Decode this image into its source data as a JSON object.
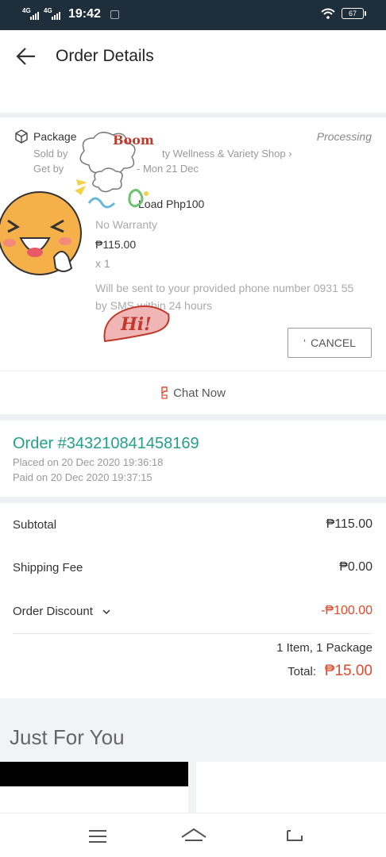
{
  "status_bar": {
    "network1": "4G",
    "network2": "4G",
    "time": "19:42",
    "battery": "67"
  },
  "header": {
    "title": "Order Details"
  },
  "package": {
    "label": "Package",
    "status": "Processing",
    "sold_by": "Sold by",
    "shop_name": "ty Wellness & Variety Shop",
    "get_by": "Get by",
    "delivery_date": "- Mon 21 Dec",
    "product_name": "Load Php100",
    "warranty": "No Warranty",
    "price": "₱115.00",
    "quantity": "x 1",
    "sms_note": "Will be sent to your provided phone number 0931 55 by SMS within 24 hours",
    "cancel_label": "CANCEL"
  },
  "chat": {
    "label": "Chat Now"
  },
  "stickers": {
    "boom_text": "Boom",
    "hi_text": "Hi!"
  },
  "order": {
    "number": "Order #343210841458169",
    "placed_on": "Placed on 20 Dec 2020  19:36:18",
    "paid_on": "Paid on 20 Dec 2020  19:37:15"
  },
  "summary": {
    "subtotal_label": "Subtotal",
    "subtotal_value": "₱115.00",
    "shipping_label": "Shipping Fee",
    "shipping_value": "₱0.00",
    "discount_label": "Order Discount",
    "discount_value": "-₱100.00",
    "items_count": "1 Item, 1 Package",
    "total_label": "Total:",
    "total_value": "₱15.00"
  },
  "just_for_you": {
    "title": "Just For You"
  },
  "colors": {
    "status_bar": "#1f2e3b",
    "order_number": "#23a08a",
    "discount": "#e04b2c"
  },
  "icons": {
    "back": "arrow-left-icon",
    "package": "package-box-icon",
    "chat": "chat-icon",
    "nav_menu": "menu-icon",
    "nav_home": "home-icon",
    "nav_back": "return-icon"
  }
}
